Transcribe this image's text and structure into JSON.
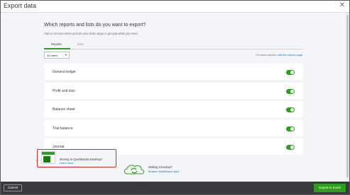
{
  "window": {
    "title": "Export data",
    "close_icon": "close-icon"
  },
  "main": {
    "heading": "Which reports and lists do you want to export?",
    "subheading": "Add or remove items and set your date range to get just what you need.",
    "tabs": [
      {
        "label": "Reports",
        "active": true
      },
      {
        "label": "Lists",
        "active": false
      }
    ],
    "date_filter": {
      "value": "All dates"
    },
    "more_reports": {
      "text": "For more reports,",
      "link": "visit the reports page"
    },
    "reports": [
      {
        "label": "General ledger",
        "enabled": true
      },
      {
        "label": "Profit and loss",
        "enabled": true
      },
      {
        "label": "Balance sheet",
        "enabled": true
      },
      {
        "label": "Trial balance",
        "enabled": true
      },
      {
        "label": "Journal",
        "enabled": true
      }
    ]
  },
  "promos": {
    "moving": {
      "title": "Moving to QuickBooks Desktop?",
      "link": "Learn more"
    },
    "backup": {
      "title": "Making a backup?",
      "link": "Browse QuickBooks apps"
    }
  },
  "footer": {
    "cancel_label": "Cancel",
    "export_label": "Export to Excel"
  },
  "colors": {
    "accent": "#2ca01c",
    "link": "#0077c5",
    "highlight": "#d52b1e",
    "footer": "#393a3d"
  }
}
